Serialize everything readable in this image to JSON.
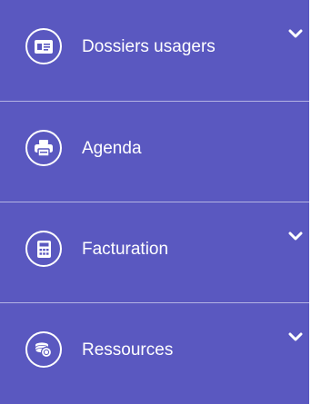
{
  "sidebar": {
    "background_color": "#5a58c0",
    "text_color": "#ffffff",
    "items": [
      {
        "label": "Dossiers usagers",
        "icon": "id-card-icon",
        "has_submenu": true,
        "active": true
      },
      {
        "label": "Agenda",
        "icon": "print-icon",
        "has_submenu": false,
        "active": false
      },
      {
        "label": "Facturation",
        "icon": "calculator-icon",
        "has_submenu": true,
        "active": false
      },
      {
        "label": "Ressources",
        "icon": "coins-icon",
        "has_submenu": true,
        "active": false
      }
    ]
  }
}
